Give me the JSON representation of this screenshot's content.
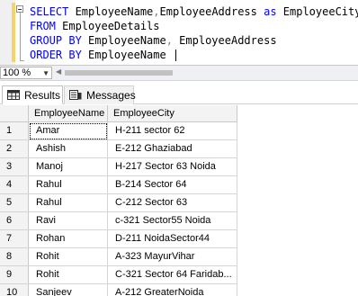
{
  "editor": {
    "lines": [
      {
        "k1": "SELECT",
        "t1": " EmployeeName",
        "g1": ",",
        "t2": "EmployeeAddress ",
        "k2": "as",
        "t3": " EmployeeCity"
      },
      {
        "k1": "FROM",
        "t1": " EmployeeDetails"
      },
      {
        "k1": "GROUP BY",
        "t1": " EmployeeName",
        "g1": ",",
        "t2": " EmployeeAddress"
      },
      {
        "k1": "ORDER BY",
        "t1": " EmployeeName "
      }
    ]
  },
  "zoom": {
    "value": "100 %"
  },
  "tabs": {
    "results": "Results",
    "messages": "Messages"
  },
  "grid": {
    "columns": [
      "EmployeeName",
      "EmployeeCity"
    ],
    "rows": [
      {
        "n": "1",
        "name": "Amar",
        "city": "H-211 sector 62"
      },
      {
        "n": "2",
        "name": "Ashish",
        "city": "E-212 Ghaziabad"
      },
      {
        "n": "3",
        "name": "Manoj",
        "city": "H-217 Sector 63 Noida"
      },
      {
        "n": "4",
        "name": "Rahul",
        "city": "B-214 Sector 64"
      },
      {
        "n": "5",
        "name": "Rahul",
        "city": "C-212 Sector 63"
      },
      {
        "n": "6",
        "name": "Ravi",
        "city": "c-321 Sector55 Noida"
      },
      {
        "n": "7",
        "name": "Rohan",
        "city": "D-211 NoidaSector44"
      },
      {
        "n": "8",
        "name": "Rohit",
        "city": "A-323 MayurVihar"
      },
      {
        "n": "9",
        "name": "Rohit",
        "city": "C-321 Sector 64 Faridab..."
      },
      {
        "n": "10",
        "name": "Sanjeev",
        "city": "A-212 GreaterNoida"
      }
    ]
  },
  "colors": {
    "keyword": "#0000ff",
    "punctuation": "#808080",
    "change_bar": "#f6d36a",
    "header_bg": "#f3f3f3"
  },
  "icons": {
    "results_tab": "grid-icon",
    "messages_tab": "messages-icon"
  }
}
